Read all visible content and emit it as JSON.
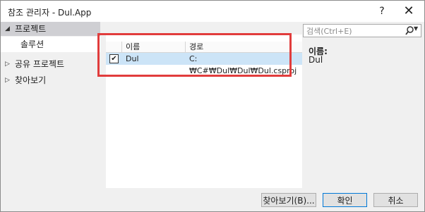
{
  "window": {
    "title": "참조 관리자 - Dul.App",
    "help_label": "?",
    "close_label": "✕"
  },
  "sidebar": {
    "items": [
      {
        "label": "프로젝트",
        "expanded": true,
        "selected": true
      },
      {
        "label": "솔루션",
        "child": true
      },
      {
        "label": "공유 프로젝트",
        "expanded": false
      },
      {
        "label": "찾아보기",
        "expanded": false
      }
    ]
  },
  "grid": {
    "columns": [
      "이름",
      "경로"
    ],
    "rows": [
      {
        "checked": true,
        "name": "Dul",
        "path": "C:₩C#₩Dul₩Dul₩Dul.csproj"
      }
    ]
  },
  "search": {
    "placeholder": "검색(Ctrl+E)",
    "icon": "search-icon"
  },
  "details": {
    "label": "이름:",
    "value": "Dul"
  },
  "footer": {
    "browse_label": "찾아보기(B)...",
    "ok_label": "확인",
    "cancel_label": "취소"
  },
  "colors": {
    "highlight": "#e13c3c",
    "selected_row": "#cce4f7",
    "primary_button_border": "#0078d7"
  }
}
